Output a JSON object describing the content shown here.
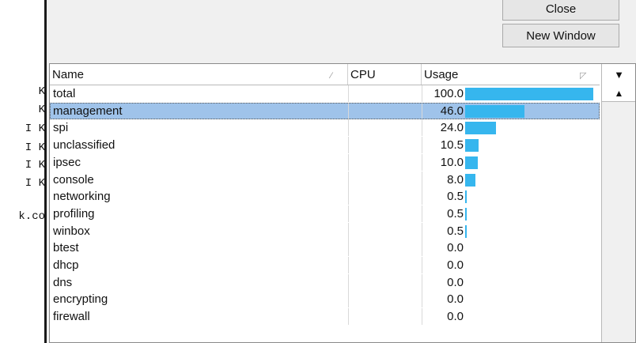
{
  "terminal": {
    "lines": [
      "K",
      "K",
      "I K",
      "I K",
      "I K",
      "I K",
      "",
      "k.co"
    ]
  },
  "buttons": {
    "close": "Close",
    "new_window": "New Window"
  },
  "table": {
    "headers": {
      "name": "Name",
      "cpu": "CPU",
      "usage": "Usage"
    },
    "max_usage": 100.0,
    "bar_color": "#36b6ee",
    "selected_color": "#9fc3ea",
    "rows": [
      {
        "name": "total",
        "usage": "100.0",
        "value": 100.0
      },
      {
        "name": "management",
        "usage": "46.0",
        "value": 46.0,
        "selected": true
      },
      {
        "name": "spi",
        "usage": "24.0",
        "value": 24.0
      },
      {
        "name": "unclassified",
        "usage": "10.5",
        "value": 10.5
      },
      {
        "name": "ipsec",
        "usage": "10.0",
        "value": 10.0
      },
      {
        "name": "console",
        "usage": "8.0",
        "value": 8.0
      },
      {
        "name": "networking",
        "usage": "0.5",
        "value": 0.5
      },
      {
        "name": "profiling",
        "usage": "0.5",
        "value": 0.5
      },
      {
        "name": "winbox",
        "usage": "0.5",
        "value": 0.5
      },
      {
        "name": "btest",
        "usage": "0.0",
        "value": 0.0
      },
      {
        "name": "dhcp",
        "usage": "0.0",
        "value": 0.0
      },
      {
        "name": "dns",
        "usage": "0.0",
        "value": 0.0
      },
      {
        "name": "encrypting",
        "usage": "0.0",
        "value": 0.0
      },
      {
        "name": "firewall",
        "usage": "0.0",
        "value": 0.0
      }
    ]
  },
  "scroll": {
    "menu_icon": "dropdown-triangle-icon",
    "up_icon": "scroll-up-icon"
  }
}
